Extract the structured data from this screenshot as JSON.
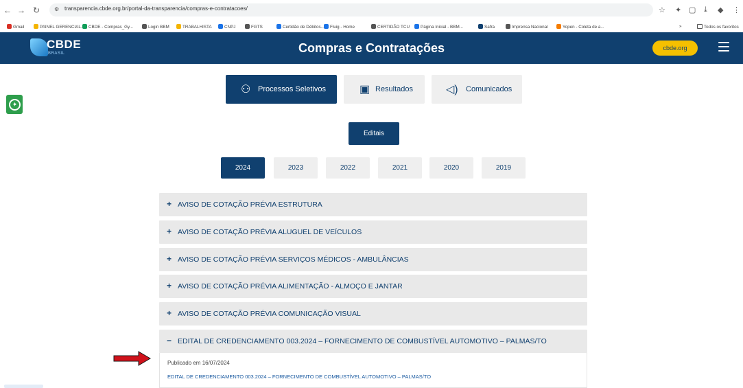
{
  "browser": {
    "url": "transparencia.cbde.org.br/portal-da-transparencia/compras-e-contratacoes/",
    "bookmarks": [
      {
        "label": "Gmail",
        "color": "#d93025"
      },
      {
        "label": "PAINEL GERENCIAL...",
        "color": "#f4b400"
      },
      {
        "label": "CBDE - Compras_Gy...",
        "color": "#0f9d58"
      },
      {
        "label": "Login BBM",
        "color": "#555555"
      },
      {
        "label": "TRABALHISTA",
        "color": "#f4b400"
      },
      {
        "label": "CNPJ",
        "color": "#1a73e8"
      },
      {
        "label": "FGTS",
        "color": "#555555"
      },
      {
        "label": "Certidão de Débitos...",
        "color": "#1a73e8"
      },
      {
        "label": "Fluig - Home",
        "color": "#1a73e8"
      },
      {
        "label": "CERTIDÃO TCU",
        "color": "#555555"
      },
      {
        "label": "Página Inicial - BBM...",
        "color": "#1a73e8"
      },
      {
        "label": "Safra",
        "color": "#10406f"
      },
      {
        "label": "Imprensa Nacional",
        "color": "#555555"
      },
      {
        "label": "Yopen - Coleta de a...",
        "color": "#f57c00"
      }
    ],
    "favorites_label": "Todos os favoritos"
  },
  "header": {
    "logo_text": "CBDE",
    "logo_sub": "BRASIL",
    "title": "Compras e Contratações",
    "site_button": "cbde.org"
  },
  "tabs": [
    {
      "label": "Processos Seletivos",
      "active": true,
      "icon": "people-icon"
    },
    {
      "label": "Resultados",
      "active": false,
      "icon": "document-check-icon"
    },
    {
      "label": "Comunicados",
      "active": false,
      "icon": "megaphone-icon"
    }
  ],
  "editais_label": "Editais",
  "years": [
    "2024",
    "2023",
    "2022",
    "2021",
    "2020",
    "2019"
  ],
  "active_year": "2024",
  "accordion": [
    {
      "sign": "+",
      "title": "AVISO DE COTAÇÃO PRÉVIA ESTRUTURA"
    },
    {
      "sign": "+",
      "title": "AVISO DE COTAÇÃO PRÉVIA ALUGUEL DE VEÍCULOS"
    },
    {
      "sign": "+",
      "title": "AVISO DE COTAÇÃO PRÉVIA SERVIÇOS MÉDICOS - AMBULÂNCIAS"
    },
    {
      "sign": "+",
      "title": "AVISO DE COTAÇÃO PRÉVIA ALIMENTAÇÃO - ALMOÇO E JANTAR"
    },
    {
      "sign": "+",
      "title": "AVISO DE COTAÇÃO PRÉVIA COMUNICAÇÃO VISUAL"
    },
    {
      "sign": "−",
      "title": "EDITAL DE CREDENCIAMENTO 003.2024 – FORNECIMENTO DE COMBUSTÍVEL AUTOMOTIVO – PALMAS/TO"
    }
  ],
  "open_item": {
    "published": "Publicado em 16/07/2024",
    "link": "EDITAL DE CREDENCIAMENTO 003.2024 – FORNECIMENTO DE COMBUSTÍVEL AUTOMOTIVO – PALMAS/TO"
  },
  "colors": {
    "primary": "#10406f",
    "accent": "#f5c000",
    "accessibility": "#2e9e4c",
    "annotation_arrow": "#d0121b"
  }
}
